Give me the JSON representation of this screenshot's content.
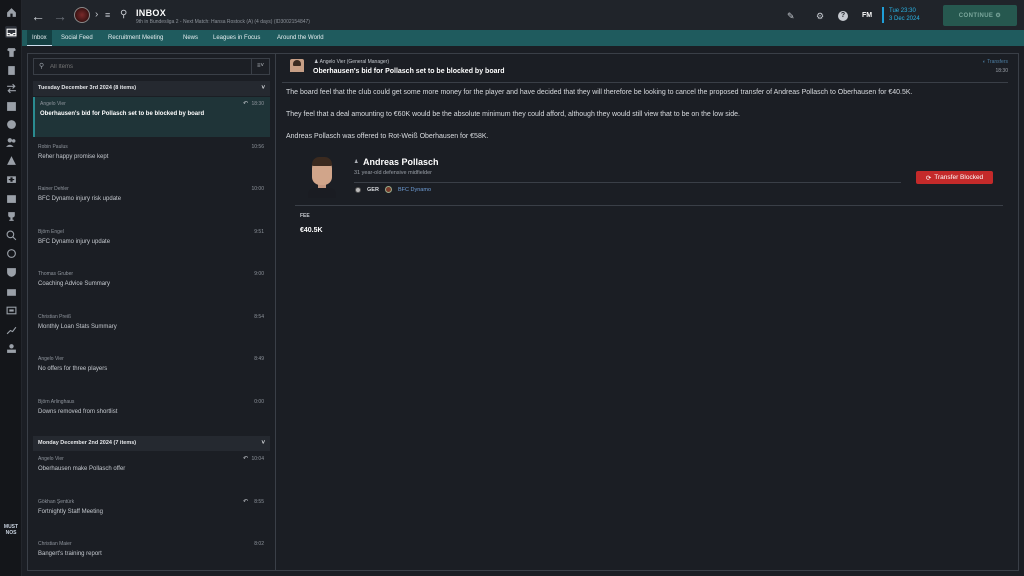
{
  "header": {
    "title": "INBOX",
    "subtitle": "9th in Bundesliga 2 - Next Match: Hansa Rostock (A) (4 days) (ID3002154847)",
    "fm_label": "FM",
    "time": "Tue 23:30",
    "date": "3 Dec 2024",
    "continue_label": "CONTINUE"
  },
  "tabs": [
    {
      "label": "Inbox",
      "active": true
    },
    {
      "label": "Social Feed"
    },
    {
      "label": "Recruitment Meeting"
    },
    {
      "label": "News"
    },
    {
      "label": "Leagues in Focus"
    },
    {
      "label": "Around the World"
    }
  ],
  "search": {
    "placeholder": "All Items"
  },
  "groups": [
    {
      "header": "Tuesday December 3rd 2024 (8 items)",
      "messages": [
        {
          "from": "Angelo Vier",
          "subject": "Oberhausen's bid for Pollasch set to be blocked by board",
          "time": "18:30",
          "replied": true,
          "active": true
        },
        {
          "from": "Robin Paulus",
          "subject": "Reher happy promise kept",
          "time": "10:56"
        },
        {
          "from": "Rainer Dehler",
          "subject": "BFC Dynamo injury risk update",
          "time": "10:00"
        },
        {
          "from": "Björn Engel",
          "subject": "BFC Dynamo injury update",
          "time": "9:51"
        },
        {
          "from": "Thomas Gruber",
          "subject": "Coaching Advice Summary",
          "time": "9:00"
        },
        {
          "from": "Christian Preiß",
          "subject": "Monthly Loan Stats Summary",
          "time": "8:54"
        },
        {
          "from": "Angelo Vier",
          "subject": "No offers for three players",
          "time": "8:49"
        },
        {
          "from": "Björn Arlinghaus",
          "subject": "Downs removed from shortlist",
          "time": "0:00"
        }
      ]
    },
    {
      "header": "Monday December 2nd 2024 (7 items)",
      "messages": [
        {
          "from": "Angelo Vier",
          "subject": "Oberhausen make Pollasch offer",
          "time": "10:04",
          "replied": true
        },
        {
          "from": "Gökhan Şentürk",
          "subject": "Fortnightly Staff Meeting",
          "time": "8:55",
          "replied": true
        },
        {
          "from": "Christian Maier",
          "subject": "Bangert's training report",
          "time": "8:02"
        }
      ]
    }
  ],
  "message": {
    "sender": "Angelo Vier  (General Manager)",
    "title": "Oberhausen's bid for Pollasch set to be blocked by board",
    "category": "Transfers",
    "time": "18:30",
    "paragraphs": [
      "The board feel that the club could get some more money for the player and have decided that they will therefore be looking to cancel the proposed transfer of Andreas Pollasch to Oberhausen for €40.5K.",
      "They feel that a deal amounting to €60K would be the absolute minimum they could afford, although they would still view that to be on the low side.",
      "Andreas Pollasch was offered to Rot-Weiß Oberhausen for €58K."
    ],
    "player": {
      "name": "Andreas Pollasch",
      "description": "31 year-old defensive midfielder",
      "nation": "GER",
      "club": "BFC Dynamo"
    },
    "status_button": "Transfer Blocked",
    "fee_label": "FEE",
    "fee_value": "€40.5K"
  },
  "rail": {
    "logo_text": "MUST NOS"
  }
}
